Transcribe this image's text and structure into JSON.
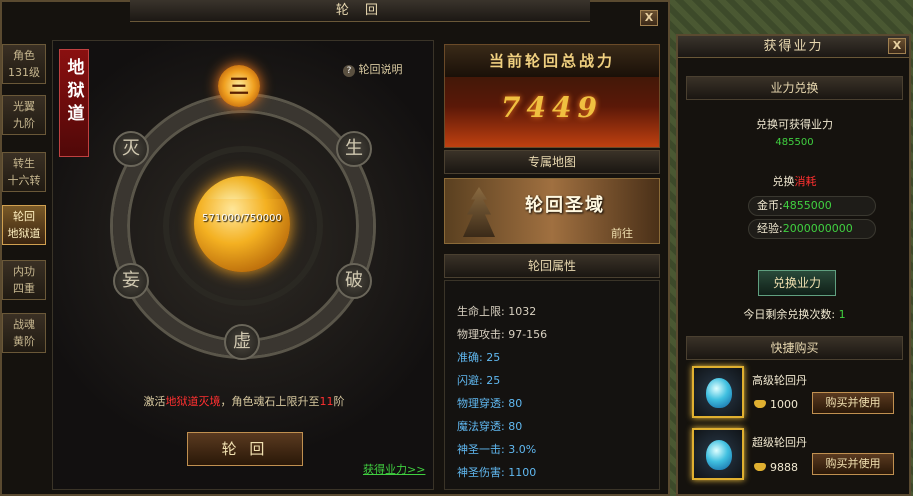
{
  "main_window": {
    "title": "轮 回",
    "close": "X",
    "help_link": "轮回说明",
    "banner_text": "地狱道",
    "side_tabs": [
      {
        "line1": "角色",
        "line2": "131级"
      },
      {
        "line1": "光翼",
        "line2": "九阶"
      },
      {
        "line1": "转生",
        "line2": "十六转"
      },
      {
        "line1": "轮回",
        "line2": "地狱道"
      },
      {
        "line1": "内功",
        "line2": "四重"
      },
      {
        "line1": "战魂",
        "line2": "黄阶"
      }
    ],
    "ring_chars": {
      "top": "三",
      "tl": "灭",
      "tr": "生",
      "ml": "妄",
      "mr": "破",
      "bottom": "虚"
    },
    "orb_progress": "571000/750000",
    "orb_progress_value": 0.761,
    "notice": {
      "pre": "激活",
      "highlight": "地狱道灭境",
      "mid": "，角色魂石上限升至",
      "num": "11",
      "post": "阶"
    },
    "reincarnate_button": "轮 回",
    "gain_link": "获得业力>>"
  },
  "power": {
    "title": "当前轮回总战力",
    "value": "7449"
  },
  "map_section": {
    "title": "专属地图",
    "map_name": "轮回圣域",
    "goto": "前往"
  },
  "attributes": {
    "title": "轮回属性",
    "rows": [
      {
        "label": "生命上限",
        "value": "1032"
      },
      {
        "label": "物理攻击",
        "value": "97-156"
      },
      {
        "label": "准确",
        "value": "25"
      },
      {
        "label": "闪避",
        "value": "25"
      },
      {
        "label": "物理穿透",
        "value": "80"
      },
      {
        "label": "魔法穿透",
        "value": "80"
      },
      {
        "label": "神圣一击",
        "value": "3.0%"
      },
      {
        "label": "神圣伤害",
        "value": "1100"
      }
    ]
  },
  "karma_window": {
    "title": "获得业力",
    "close": "X",
    "exchange_title": "业力兑换",
    "can_exchange_label": "兑换可获得业力",
    "can_exchange_value": "485500",
    "cost_label_pre": "兑换",
    "cost_label_hl": "消耗",
    "gold_label": "金币:",
    "gold_value": "4855000",
    "exp_label": "经验:",
    "exp_value": "2000000000",
    "exchange_button": "兑换业力",
    "remaining_label": "今日剩余兑换次数:",
    "remaining_value": "1",
    "quick_buy_title": "快捷购买",
    "items": [
      {
        "name": "高级轮回丹",
        "price": "1000",
        "button": "购买并使用"
      },
      {
        "name": "超级轮回丹",
        "price": "9888",
        "button": "购买并使用"
      }
    ]
  },
  "colors": {
    "accent_green": "#40d040",
    "accent_red": "#ff3030",
    "gold": "#f0c040",
    "attr_blue": "#60b8f0"
  }
}
